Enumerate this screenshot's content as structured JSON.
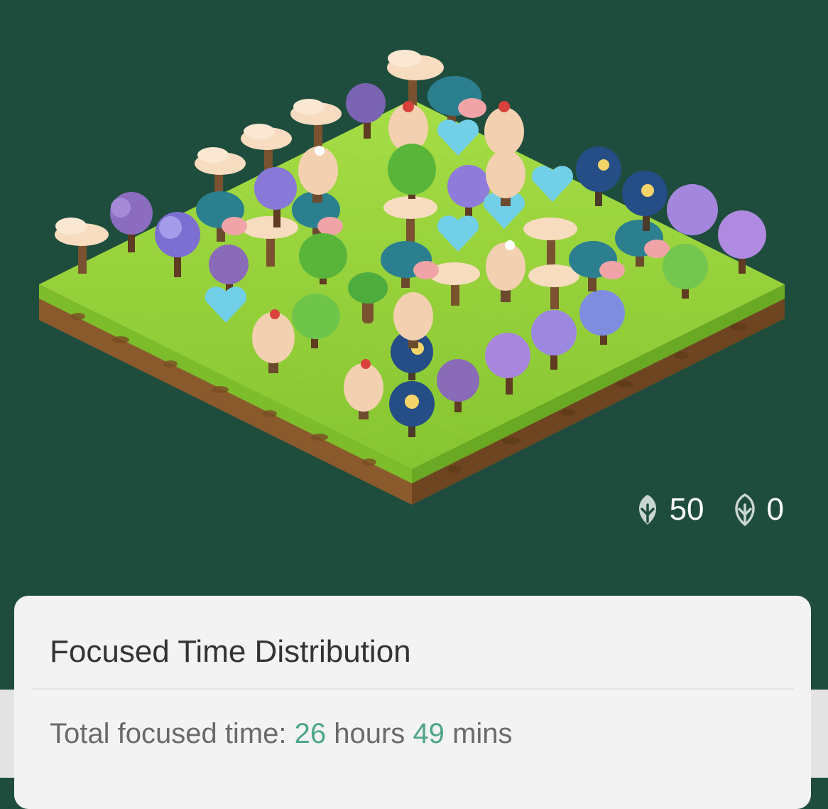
{
  "stats": {
    "healthy_count": "50",
    "withered_count": "0",
    "healthy_icon": "healthy-tree-badge-icon",
    "withered_icon": "withered-tree-badge-icon"
  },
  "card": {
    "title": "Focused Time Distribution",
    "total_label": "Total focused time:",
    "hours_value": "26",
    "hours_unit": "hours",
    "mins_value": "49",
    "mins_unit": "mins"
  },
  "colors": {
    "background": "#1f4d3d",
    "accent": "#4ea58a",
    "card": "#f3f3f3"
  }
}
